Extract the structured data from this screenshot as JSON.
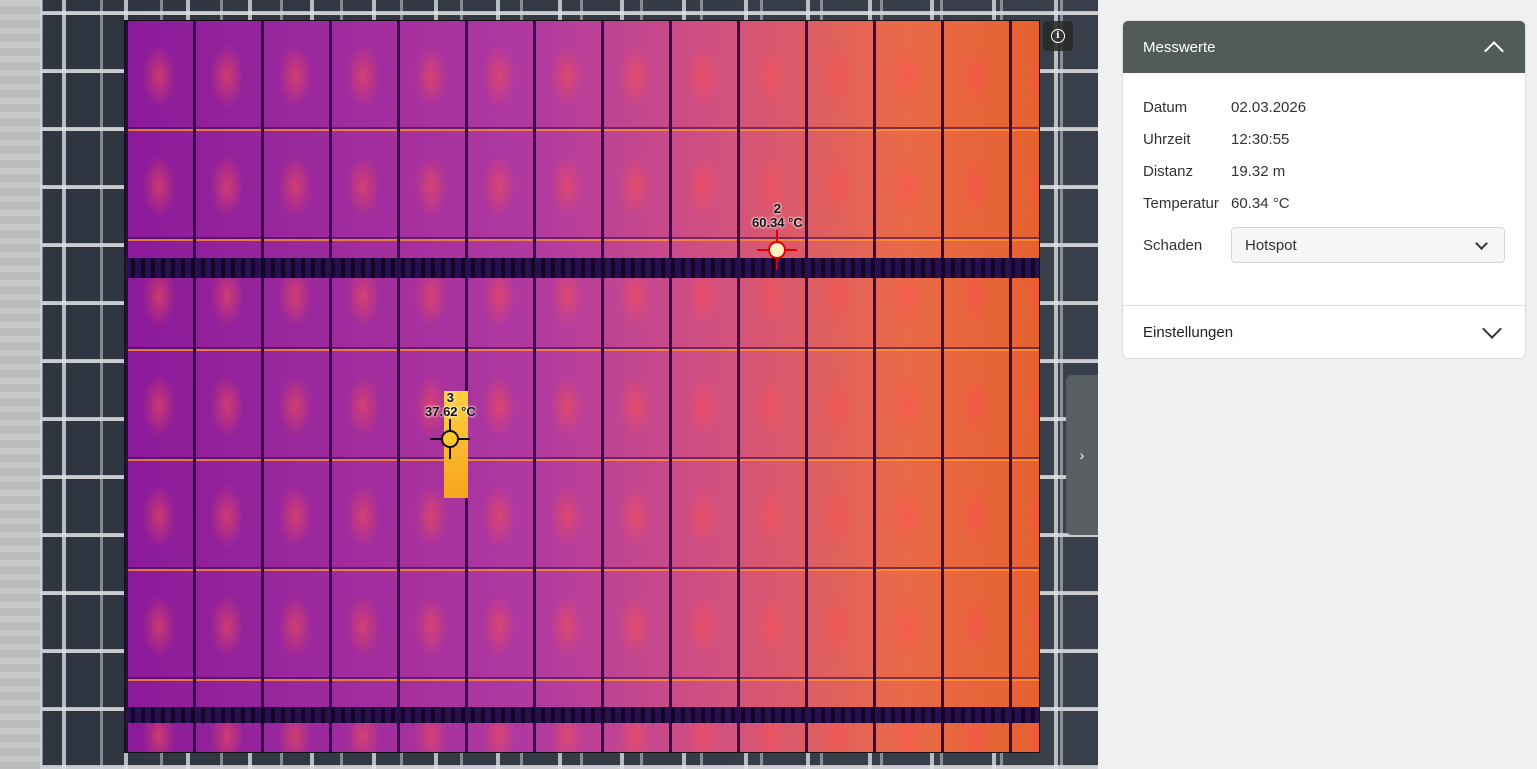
{
  "viewer": {
    "info_icon": "info-icon",
    "collapse_icon": "chevron-right-icon",
    "collapse_label": "›",
    "markers": [
      {
        "id": "2",
        "temperature": "60.34 °C",
        "color": "#d00000"
      },
      {
        "id": "3",
        "temperature": "37.62 °C",
        "color": "#111111"
      }
    ]
  },
  "panel": {
    "title": "Messwerte",
    "fields": [
      {
        "label": "Datum",
        "value": "02.03.2026"
      },
      {
        "label": "Uhrzeit",
        "value": "12:30:55"
      },
      {
        "label": "Distanz",
        "value": "19.32 m"
      },
      {
        "label": "Temperatur",
        "value": "60.34 °C"
      }
    ],
    "damage": {
      "label": "Schaden",
      "selected": "Hotspot"
    },
    "settings_label": "Einstellungen"
  }
}
